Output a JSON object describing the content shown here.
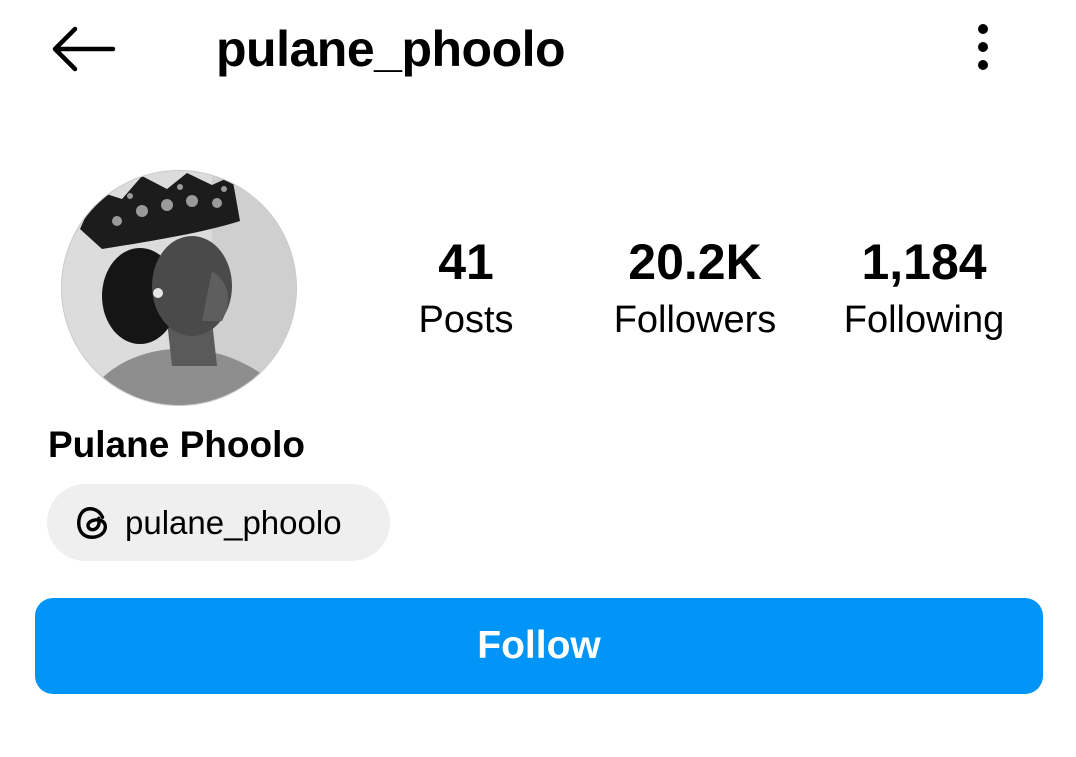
{
  "header": {
    "username": "pulane_phoolo",
    "back_icon": "arrow-left-icon",
    "more_icon": "vertical-ellipsis-icon"
  },
  "profile": {
    "avatar_icon": "profile-photo",
    "display_name": "Pulane Phoolo",
    "stats": {
      "posts": {
        "value": "41",
        "label": "Posts"
      },
      "followers": {
        "value": "20.2K",
        "label": "Followers"
      },
      "following": {
        "value": "1,184",
        "label": "Following"
      }
    },
    "threads": {
      "icon": "threads-icon",
      "handle": "pulane_phoolo"
    }
  },
  "actions": {
    "follow_label": "Follow"
  },
  "colors": {
    "accent": "#0095f6",
    "chip_background": "#efefef",
    "text": "#000000",
    "background": "#ffffff"
  }
}
